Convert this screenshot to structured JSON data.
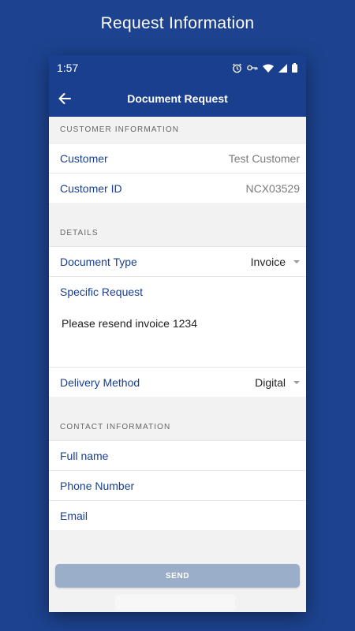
{
  "promo_title": "Request Information",
  "status_bar": {
    "time": "1:57"
  },
  "app_bar": {
    "title": "Document Request"
  },
  "customer_section": {
    "header": "CUSTOMER INFORMATION",
    "rows": [
      {
        "label": "Customer",
        "value": "Test Customer"
      },
      {
        "label": "Customer ID",
        "value": "NCX03529"
      }
    ]
  },
  "details_section": {
    "header": "DETAILS",
    "document_type": {
      "label": "Document Type",
      "value": "Invoice"
    },
    "specific_request": {
      "label": "Specific Request",
      "value": "Please resend invoice 1234"
    },
    "delivery_method": {
      "label": "Delivery Method",
      "value": "Digital"
    }
  },
  "contact_section": {
    "header": "CONTACT INFORMATION",
    "fields": [
      {
        "label": "Full name"
      },
      {
        "label": "Phone Number"
      },
      {
        "label": "Email"
      }
    ]
  },
  "send_button": {
    "label": "SEND"
  },
  "colors": {
    "primary": "#1a3f8f",
    "background": "#1d4390",
    "button_disabled": "#9aadc9"
  }
}
